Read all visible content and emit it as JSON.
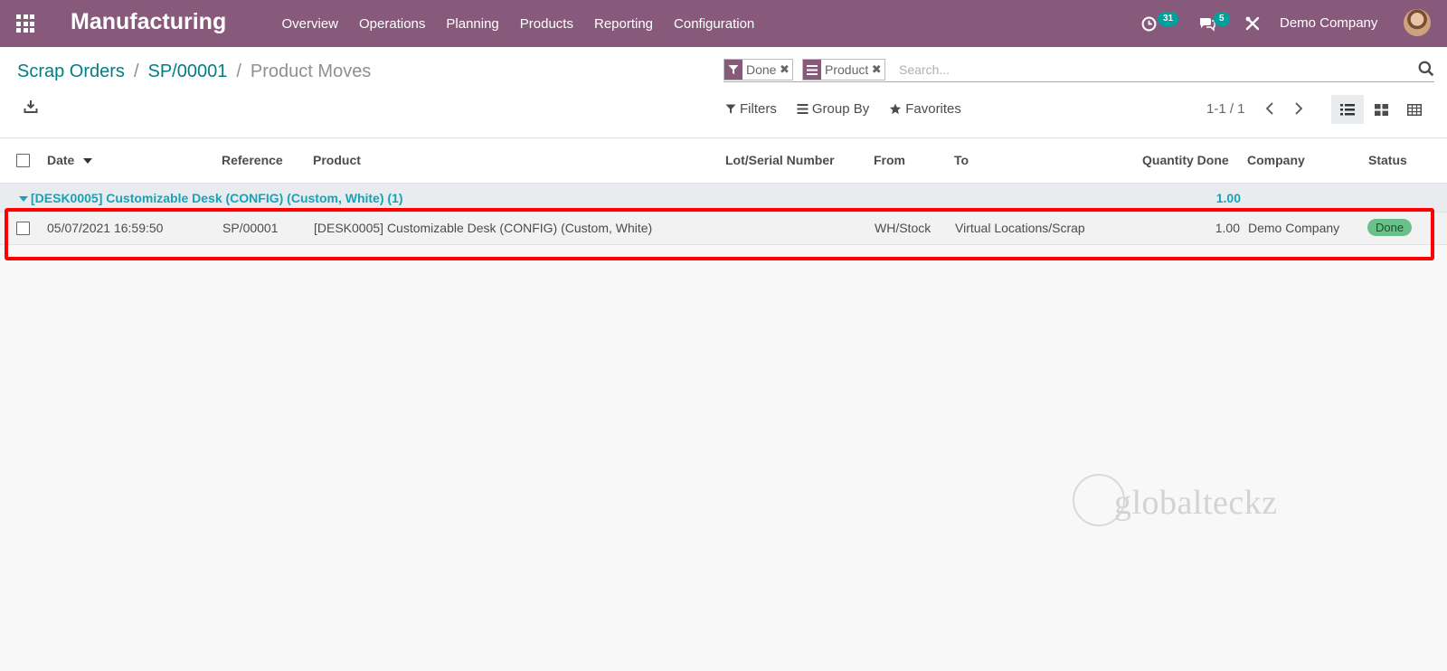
{
  "navbar": {
    "app_title": "Manufacturing",
    "menu": [
      "Overview",
      "Operations",
      "Planning",
      "Products",
      "Reporting",
      "Configuration"
    ],
    "activity_count": "31",
    "message_count": "5",
    "company": "Demo Company",
    "brand_color": "#875a7b",
    "icons": [
      "apps-grid-icon",
      "clock-icon",
      "chat-icon",
      "tools-icon"
    ]
  },
  "breadcrumb": {
    "items": [
      "Scrap Orders",
      "SP/00001"
    ],
    "separator": "/",
    "current": "Product Moves"
  },
  "search": {
    "facets": [
      {
        "icon": "filter-icon",
        "label": "Done"
      },
      {
        "icon": "group-by-icon",
        "label": "Product"
      }
    ],
    "placeholder": "Search..."
  },
  "filters": {
    "filters_label": "Filters",
    "group_by_label": "Group By",
    "favorites_label": "Favorites"
  },
  "pager": {
    "value": "1-1 / 1"
  },
  "views": [
    "list-view-icon",
    "kanban-view-icon",
    "pivot-view-icon"
  ],
  "table": {
    "columns": {
      "date": "Date",
      "reference": "Reference",
      "product": "Product",
      "lot": "Lot/Serial Number",
      "from": "From",
      "to": "To",
      "quantity": "Quantity Done",
      "company": "Company",
      "status": "Status"
    },
    "group": {
      "label": "[DESK0005] Customizable Desk (CONFIG) (Custom, White) (1)",
      "sum": "1.00"
    },
    "rows": [
      {
        "date": "05/07/2021 16:59:50",
        "reference": "SP/00001",
        "product": "[DESK0005] Customizable Desk (CONFIG) (Custom, White)",
        "lot": "",
        "from": "WH/Stock",
        "to": "Virtual Locations/Scrap",
        "quantity": "1.00",
        "company": "Demo Company",
        "status": "Done"
      }
    ]
  },
  "watermark": {
    "text": "globalteckz"
  },
  "colors": {
    "accent": "#017e84",
    "group_text": "#17a2b8",
    "status_done": "#69c18a",
    "highlight": "#ff0000"
  }
}
